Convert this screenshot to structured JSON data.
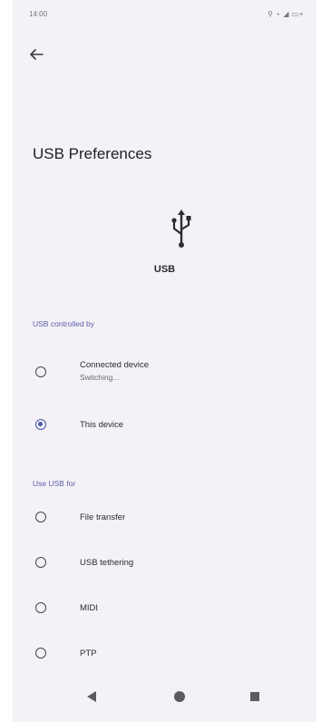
{
  "status_bar": {
    "time": "14:00",
    "icons": "⚲ ⋆ ◢ ▭+"
  },
  "header": {
    "back_icon": "arrow-left-icon"
  },
  "page": {
    "title": "USB Preferences"
  },
  "usb": {
    "icon": "usb-icon",
    "label": "USB"
  },
  "sections": {
    "controlled_by": {
      "header": "USB controlled by",
      "options": [
        {
          "label": "Connected device",
          "sublabel": "Switching...",
          "selected": false
        },
        {
          "label": "This device",
          "selected": true
        }
      ]
    },
    "use_for": {
      "header": "Use USB for",
      "options": [
        {
          "label": "File transfer",
          "selected": false
        },
        {
          "label": "USB tethering",
          "selected": false
        },
        {
          "label": "MIDI",
          "selected": false
        },
        {
          "label": "PTP",
          "selected": false
        }
      ]
    }
  },
  "nav_bar": {
    "back": "nav-back-icon",
    "home": "nav-home-icon",
    "recents": "nav-recents-icon"
  },
  "colors": {
    "accent": "#4c57a8",
    "background": "#f4f1f7",
    "text": "#2b2b31"
  }
}
